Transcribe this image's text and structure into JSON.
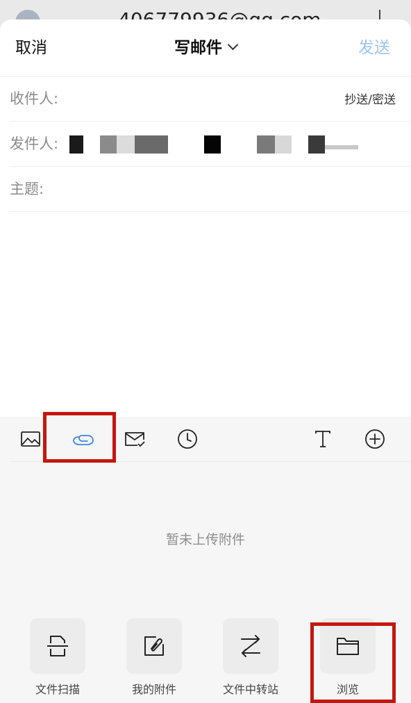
{
  "background": {
    "email_partial": "406779936@qq.com"
  },
  "header": {
    "cancel_label": "取消",
    "title": "写邮件",
    "send_label": "发送"
  },
  "fields": {
    "to_label": "收件人:",
    "cc_bcc_label": "抄送/密送",
    "from_label": "发件人:",
    "subject_label": "主题:"
  },
  "toolbar": {
    "items": [
      "image-icon",
      "attachment-icon",
      "mail-check-icon",
      "clock-icon",
      "text-format-icon",
      "add-circle-icon"
    ]
  },
  "attachments": {
    "empty_text": "暂未上传附件"
  },
  "actions": [
    {
      "label": "文件扫描",
      "icon": "file-scan-icon"
    },
    {
      "label": "我的附件",
      "icon": "my-attachment-icon"
    },
    {
      "label": "文件中转站",
      "icon": "transfer-icon"
    },
    {
      "label": "浏览",
      "icon": "folder-icon"
    }
  ],
  "colors": {
    "accent_disabled": "#9cc6f0",
    "active_icon": "#3a86e0",
    "highlight_box": "#c4170f"
  }
}
